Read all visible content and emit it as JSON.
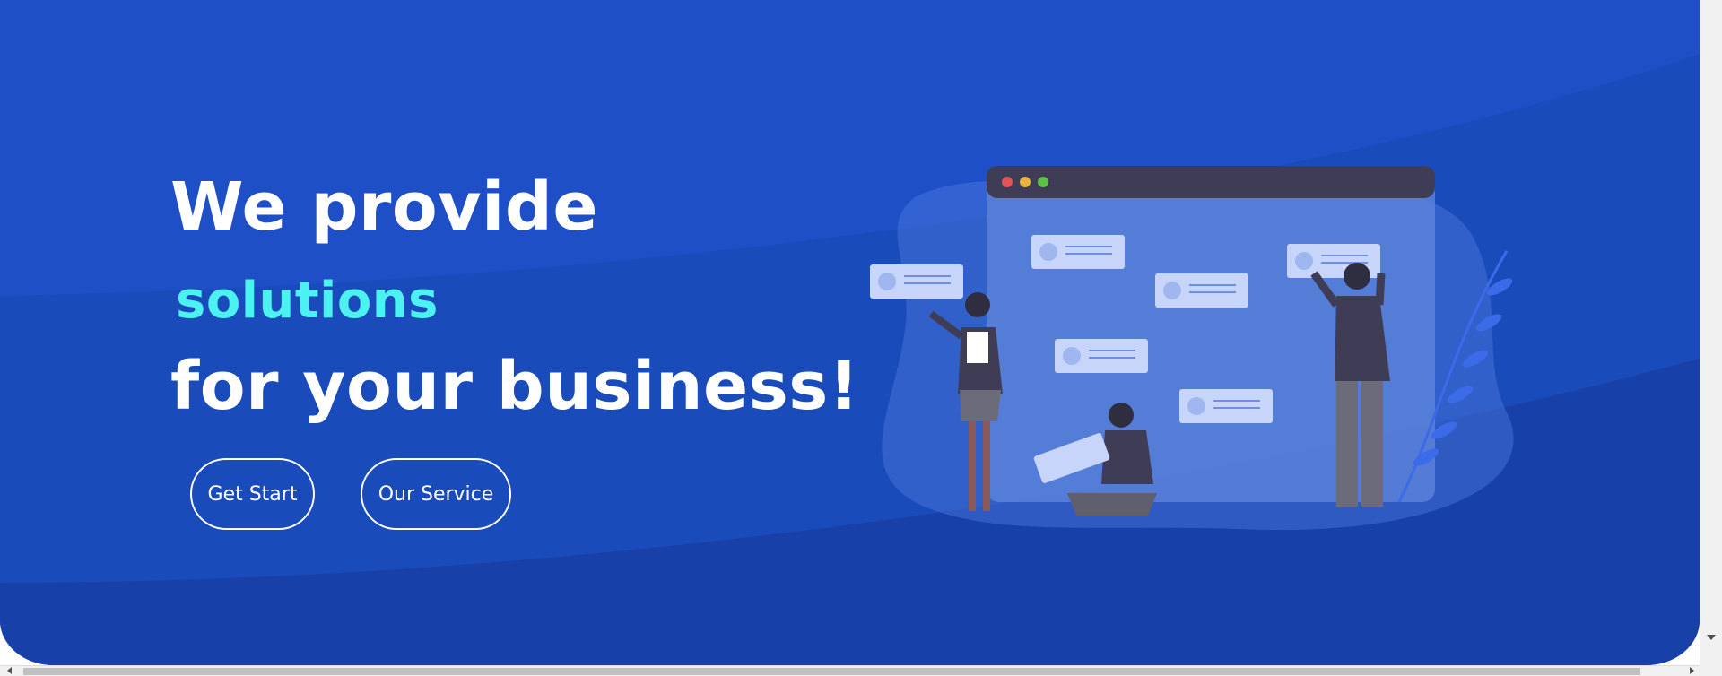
{
  "hero": {
    "line1": "We provide",
    "line2": "solutions",
    "line3": "for your business!",
    "buttons": {
      "get_start": "Get Start",
      "our_service": "Our Service"
    },
    "colors": {
      "background": "#1e4fc6",
      "accent": "#4cf2f2",
      "text": "#ffffff"
    }
  },
  "illustration": {
    "icon": "team-collaboration-illustration"
  }
}
